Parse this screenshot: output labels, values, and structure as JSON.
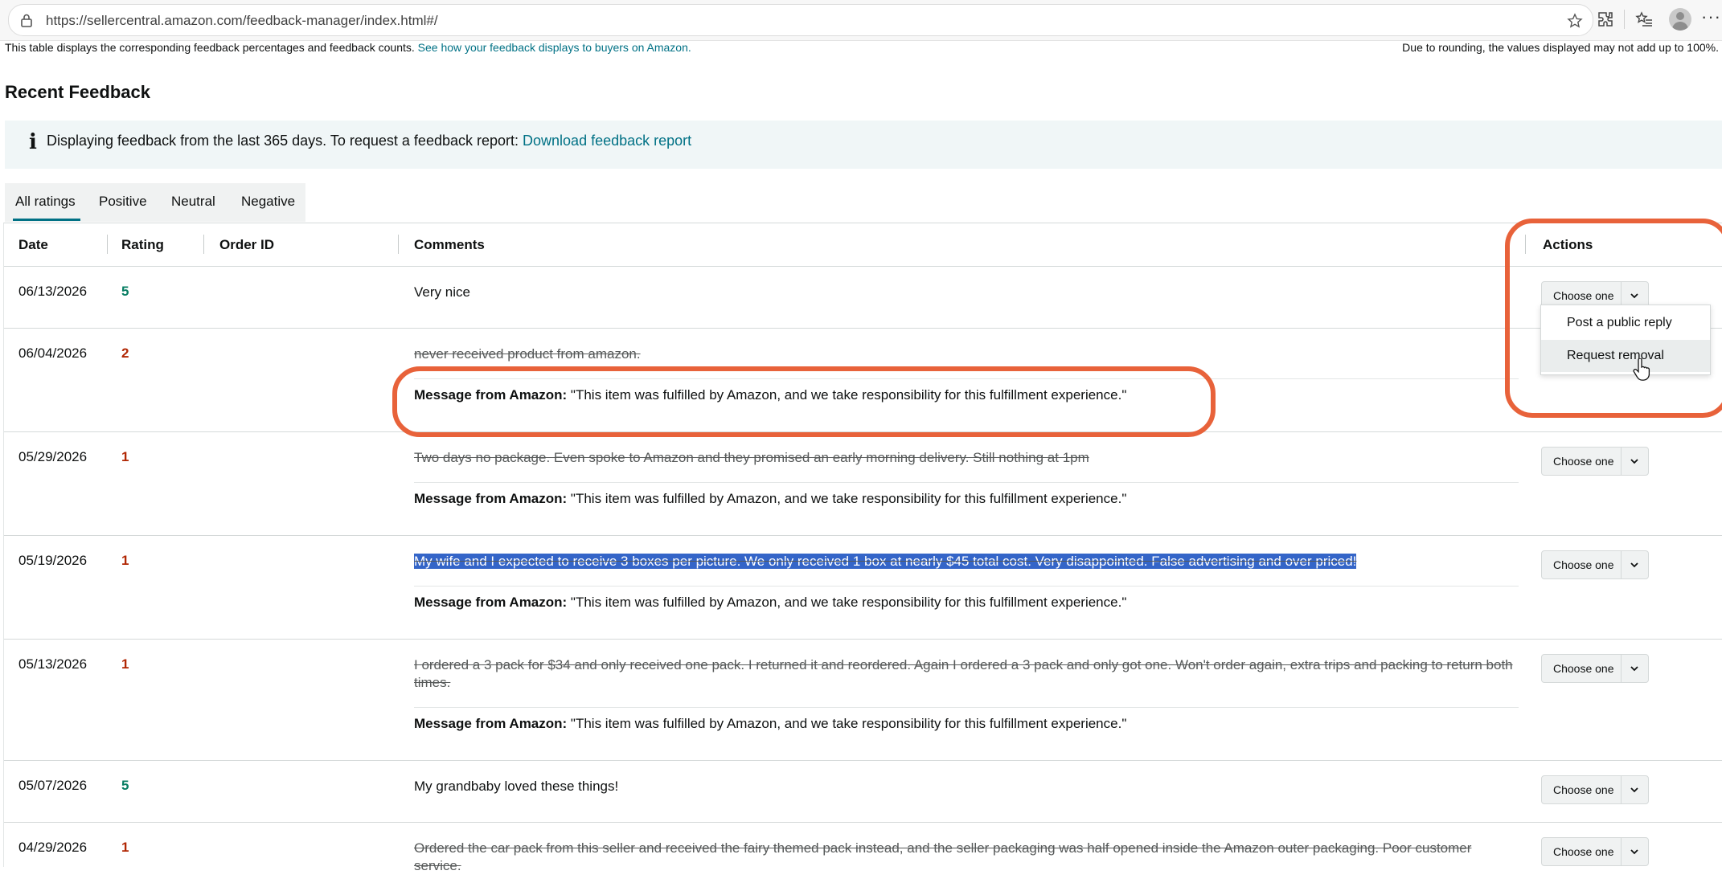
{
  "browser": {
    "url": "https://sellercentral.amazon.com/feedback-manager/index.html#/",
    "more": "···"
  },
  "info": {
    "text": "This table displays the corresponding feedback percentages and feedback counts.",
    "link": "See how your feedback displays to buyers on Amazon.",
    "rounding_note": "Due to rounding, the values displayed may not add up to 100%."
  },
  "section_title": "Recent Feedback",
  "alert": {
    "icon": "info-icon",
    "text": "Displaying feedback from the last 365 days. To request a feedback report:",
    "link": "Download feedback report"
  },
  "tabs": [
    {
      "label": "All ratings",
      "active": true
    },
    {
      "label": "Positive",
      "active": false
    },
    {
      "label": "Neutral",
      "active": false
    },
    {
      "label": "Negative",
      "active": false
    }
  ],
  "table": {
    "headers": {
      "date": "Date",
      "rating": "Rating",
      "order_id": "Order ID",
      "comments": "Comments",
      "actions": "Actions"
    },
    "amazon_message_label": "Message from Amazon:",
    "amazon_message_text": "\"This item was fulfilled by Amazon, and we take responsibility for this fulfillment experience.\"",
    "action_label": "Choose one",
    "rows": [
      {
        "date": "06/13/2026",
        "rating": "5",
        "comment": "Very nice"
      },
      {
        "date": "06/04/2026",
        "rating": "2",
        "comment": "never received product from amazon."
      },
      {
        "date": "05/29/2026",
        "rating": "1",
        "comment": "Two days no package. Even spoke to Amazon and they promised an early morning delivery. Still nothing at 1pm"
      },
      {
        "date": "05/19/2026",
        "rating": "1",
        "comment": "My wife and I expected to receive 3 boxes per picture. We only received 1 box at nearly $45 total cost. Very disappointed. False advertising and over priced!"
      },
      {
        "date": "05/13/2026",
        "rating": "1",
        "comment": "I ordered a 3 pack for $34 and only received one pack. I returned it and reordered. Again I ordered a 3 pack and only got one. Won't order again, extra trips and packing to return both times."
      },
      {
        "date": "05/07/2026",
        "rating": "5",
        "comment": "My grandbaby loved these things!"
      },
      {
        "date": "04/29/2026",
        "rating": "1",
        "comment": "Ordered the car pack from this seller and received the fairy themed pack instead, and the seller packaging was half opened inside the Amazon outer packaging. Poor customer service."
      }
    ]
  },
  "dropdown": {
    "items": [
      "Post a public reply",
      "Request removal"
    ]
  },
  "colors": {
    "link": "#007185",
    "positive": "#067d62",
    "negative": "#b12704",
    "annotation": "#e8623a",
    "selection": "#3465c8"
  }
}
